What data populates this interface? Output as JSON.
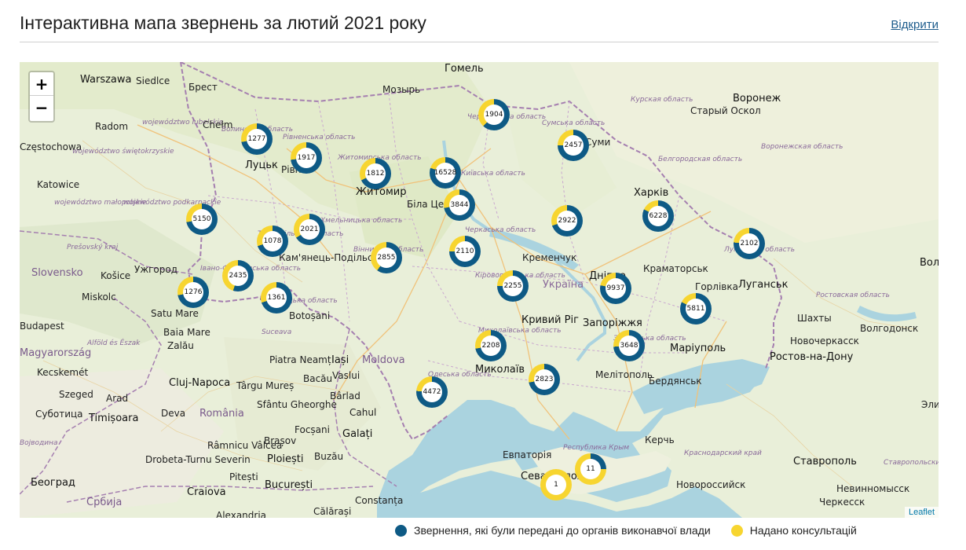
{
  "header": {
    "title": "Інтерактивна мапа звернень за лютий 2021 року",
    "open_link": "Відкрити"
  },
  "colors": {
    "primary": "#0e5a85",
    "secondary": "#f7d530"
  },
  "map": {
    "zoom_in": "+",
    "zoom_out": "−",
    "attribution": "Leaflet",
    "labels": {
      "warszawa": "Warszawa",
      "siedlce": "Siedlce",
      "brest": "Брест",
      "gomel": "Гомель",
      "mozyr": "Мозырь",
      "radom": "Radom",
      "lubelskie": "województwo lubelskie",
      "chelm": "Chełm",
      "czestochowa": "Częstochowa",
      "swietokrzyskie": "województwo świętokrzyskie",
      "katowice": "Katowice",
      "malopolskie": "województwo małopolskie",
      "podkarpackie": "województwo podkarpackie",
      "lutsk": "Луцьк",
      "rivne": "Рівне",
      "zhytomyr": "Житомир",
      "bila_tserkva": "Біла Церква",
      "kursk": "Курская область",
      "voronezh": "Воронеж",
      "staryi_oskol": "Старый Оскол",
      "sumy_obl": "Сумська область",
      "sumy": "Суми",
      "belgorod": "Белгородская область",
      "voronezh_obl": "Воронежская область",
      "kharkiv": "Харків",
      "kremenchuk": "Кременчук",
      "kirovohrad": "Кіровоградська область",
      "kramatorsk": "Краматорськ",
      "dnipro": "Дніпро",
      "ukraina": "Україна",
      "horlivka": "Горлівка",
      "luhansk": "Луганськ",
      "rostov_obl": "Ростовская область",
      "shakhty": "Шахты",
      "volgodonsk": "Волгодонск",
      "novocherkassk": "Новочеркасск",
      "rostov": "Ростов-на-Дону",
      "kryvyi_rih": "Кривий Ріг",
      "zaporizhzhia": "Запоріжжя",
      "mariupol": "Маріуполь",
      "mykolaiv": "Миколаїв",
      "melitopol": "Мелітополь",
      "berdiansk": "Бердянськ",
      "odeska": "Одеська область",
      "kamianets": "Кам'янець-Подільський",
      "slovensko": "Slovensko",
      "presov": "Prešovský kraj",
      "kosice": "Košice",
      "uzhhorod": "Ужгород",
      "miskolc": "Miskolc",
      "satu_mare": "Satu Mare",
      "botosani": "Botoșani",
      "suceava": "Suceava",
      "budapest": "Budapest",
      "baia_mare": "Baia Mare",
      "magyarorszag": "Magyarország",
      "alfold": "Alföld és Észak",
      "zalau": "Zalău",
      "piatra": "Piatra Neamț",
      "iasi": "Iași",
      "moldova": "Moldova",
      "kecskemet": "Kecskemét",
      "cluj": "Cluj-Napoca",
      "targu_mures": "Târgu Mureș",
      "bacau": "Bacău",
      "vaslui": "Vaslui",
      "szeged": "Szeged",
      "arad": "Arad",
      "barlad": "Bârlad",
      "sfantu": "Sfântu Gheorghe",
      "subotica": "Суботица",
      "timisoara": "Timișoara",
      "deva": "Deva",
      "romania": "România",
      "cahul": "Cahul",
      "focsani": "Focșani",
      "brasov": "Brașov",
      "galati": "Galați",
      "vojvodina": "Војводина",
      "ramnicu": "Râmnicu Vâlcea",
      "buzau": "Buzău",
      "drobeta": "Drobeta-Turnu Severin",
      "ploiesti": "Ploiești",
      "pitesti": "Pitești",
      "beograd": "Београд",
      "craiova": "Craiova",
      "bucuresti": "București",
      "srbija": "Србија",
      "constanta": "Constanța",
      "calarasi": "Călărași",
      "alexandria": "Alexandria",
      "yevpatoriia": "Евпаторія",
      "sevastopol": "Севастополь",
      "respublika": "Республика Крым",
      "kerch": "Керчь",
      "krasnodar_krai": "Краснодарский край",
      "stavropol": "Ставрополь",
      "stavropol_krai": "Ставропольский край",
      "novorossiysk": "Новороссийск",
      "nevinnomyssk": "Невинномысск",
      "cherkessk": "Черкесск",
      "elista": "Элиста",
      "vol": "Вол",
      "volynska": "Волинська область",
      "rivnenska": "Рівненська область",
      "zhytomyrska": "Житомирська область",
      "kyivska": "Київська область",
      "chernihivska": "Чернігівська область",
      "cherkaska": "Черкаська область",
      "vinnytska": "Вінницька область",
      "khmelnytska": "Хмельницька область",
      "ternopilska": "Тернопільська область",
      "ivano": "Івано-Франківська область",
      "chernivetska": "Чернівецька область",
      "mykolaivska": "Миколаївська область",
      "zaporizka": "Запорізька область",
      "luhanska": "Луганська область"
    },
    "markers": [
      {
        "name": "volynska",
        "value": "1277",
        "share": 0.72
      },
      {
        "name": "rivnenska",
        "value": "1917",
        "share": 0.73
      },
      {
        "name": "zhytomyrska",
        "value": "1812",
        "share": 0.68
      },
      {
        "name": "kyivska",
        "value": "16528",
        "share": 0.8
      },
      {
        "name": "chernihivska",
        "value": "1904",
        "share": 0.62
      },
      {
        "name": "sumska",
        "value": "2457",
        "share": 0.75
      },
      {
        "name": "lvivska",
        "value": "5150",
        "share": 0.72
      },
      {
        "name": "ternopilska",
        "value": "1078",
        "share": 0.7
      },
      {
        "name": "khmelnytska",
        "value": "2021",
        "share": 0.66
      },
      {
        "name": "kyiv-city",
        "value": "3844",
        "share": 0.72
      },
      {
        "name": "kharkivska",
        "value": "6228",
        "share": 0.82
      },
      {
        "name": "poltavska",
        "value": "2922",
        "share": 0.7
      },
      {
        "name": "luhanska",
        "value": "2102",
        "share": 0.76
      },
      {
        "name": "vinnytska",
        "value": "2855",
        "share": 0.6
      },
      {
        "name": "cherkaska",
        "value": "2110",
        "share": 0.75
      },
      {
        "name": "ivano-frankivska",
        "value": "2435",
        "share": 0.55
      },
      {
        "name": "zakarpatska",
        "value": "1276",
        "share": 0.72
      },
      {
        "name": "chernivetska",
        "value": "1361",
        "share": 0.7
      },
      {
        "name": "kirovohradska",
        "value": "2255",
        "share": 0.75
      },
      {
        "name": "dnipropetrovska",
        "value": "9937",
        "share": 0.78
      },
      {
        "name": "donetska",
        "value": "5811",
        "share": 0.82
      },
      {
        "name": "zaporizka",
        "value": "3648",
        "share": 0.74
      },
      {
        "name": "mykolaivska",
        "value": "2208",
        "share": 0.72
      },
      {
        "name": "khersonska",
        "value": "2823",
        "share": 0.72
      },
      {
        "name": "odeska",
        "value": "4472",
        "share": 0.76
      },
      {
        "name": "crimea",
        "value": "11",
        "share": 0.25
      },
      {
        "name": "sevastopol",
        "value": "1",
        "share": 0.0
      }
    ]
  },
  "legend": {
    "primary_label": "Звернення, які були передані до органів виконавчої влади",
    "secondary_label": "Надано консультацій"
  }
}
